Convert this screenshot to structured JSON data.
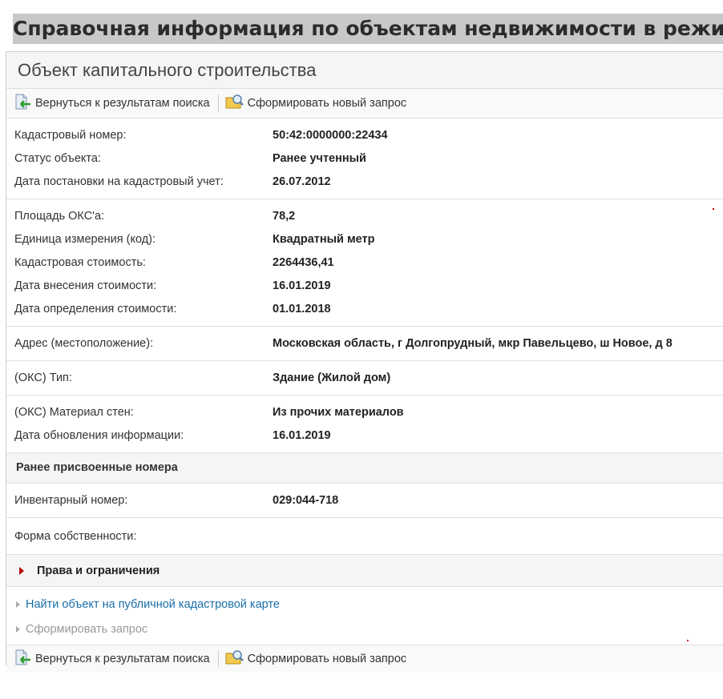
{
  "page_title": "Справочная информация по объектам недвижимости в режиме online",
  "panel": {
    "title": "Объект капитального строительства"
  },
  "toolbar": {
    "back_label": "Вернуться к результатам поиска",
    "new_request_label": "Сформировать новый запрос"
  },
  "sections": {
    "s1": [
      {
        "label": "Кадастровый номер:",
        "value": "50:42:0000000:22434"
      },
      {
        "label": "Статус объекта:",
        "value": "Ранее учтенный"
      },
      {
        "label": "Дата постановки на кадастровый учет:",
        "value": "26.07.2012"
      }
    ],
    "s2": [
      {
        "label": "Площадь ОКС'а:",
        "value": "78,2"
      },
      {
        "label": "Единица измерения (код):",
        "value": "Квадратный метр"
      },
      {
        "label": "Кадастровая стоимость:",
        "value": "2264436,41"
      },
      {
        "label": "Дата внесения стоимости:",
        "value": "16.01.2019"
      },
      {
        "label": "Дата определения стоимости:",
        "value": "01.01.2018"
      }
    ],
    "s3": [
      {
        "label": "Адрес (местоположение):",
        "value": "Московская область, г Долгопрудный, мкр Павельцево, ш Новое, д 8"
      }
    ],
    "s4": [
      {
        "label": "(ОКС) Тип:",
        "value": "Здание (Жилой дом)"
      }
    ],
    "s5": [
      {
        "label": "(ОКС) Материал стен:",
        "value": "Из прочих материалов"
      },
      {
        "label": "Дата обновления информации:",
        "value": "16.01.2019"
      }
    ],
    "previous_numbers_heading": "Ранее присвоенные номера",
    "s6": [
      {
        "label": "Инвентарный номер:",
        "value": "029:044-718"
      }
    ],
    "s7": [
      {
        "label": "Форма собственности:",
        "value": ""
      }
    ]
  },
  "rights_label": "Права и ограничения",
  "links": {
    "find_on_map": "Найти объект на публичной кадастровой карте",
    "make_request": "Сформировать запрос"
  },
  "colors": {
    "link": "#1a6ea8",
    "disabled_link": "#999999",
    "rights_arrow": "#b30000",
    "title_bar": "#c8c8c8"
  },
  "icons": {
    "back": "document-back-arrow-icon",
    "new_request": "folder-search-icon"
  }
}
